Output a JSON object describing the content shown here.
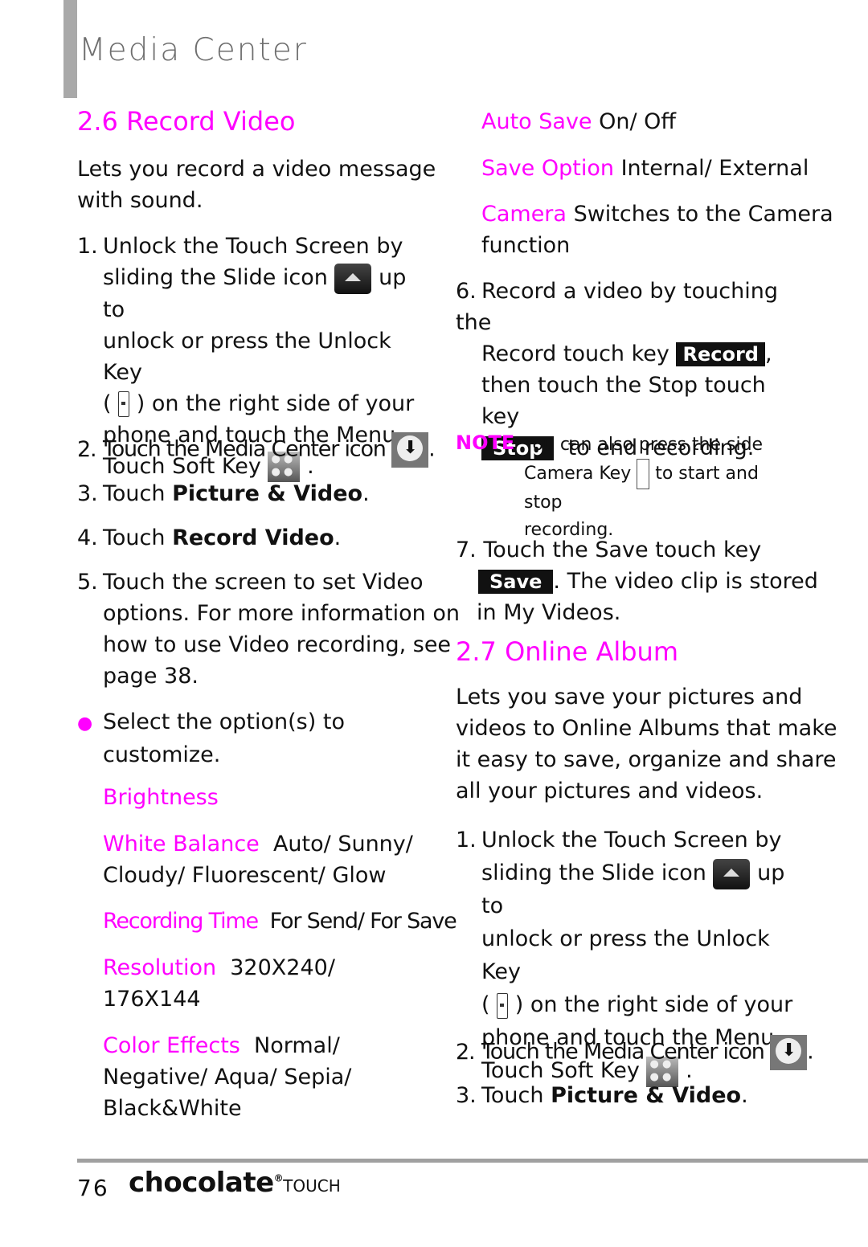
{
  "header": {
    "chapter": "Media Center"
  },
  "left": {
    "section_title": "2.6 Record Video",
    "intro": [
      "Lets you record a video message",
      "with sound."
    ],
    "step1": {
      "num": "1.",
      "l1": "Unlock the Touch Screen by",
      "l2a": "sliding the Slide icon",
      "l2b": "up to",
      "l3": "unlock or press the Unlock Key",
      "l4a": "(",
      "l4b": ") on the right side of your",
      "l5": "phone and touch the Menu",
      "l6": "Touch Soft Key",
      "l6end": "."
    },
    "step2": {
      "num": "2.",
      "text": "Touch the Media Center icon",
      "end": "."
    },
    "step3": {
      "num": "3.",
      "pre": "Touch ",
      "bold": "Picture & Video",
      "end": "."
    },
    "step4": {
      "num": "4.",
      "pre": "Touch ",
      "bold": "Record Video",
      "end": "."
    },
    "step5": {
      "num": "5.",
      "lines": [
        "Touch the screen to set Video",
        "options. For more information on",
        "how to use Video recording, see",
        "page 38."
      ]
    },
    "bullet": {
      "symbol": "●",
      "lines": [
        "Select the option(s) to",
        "customize."
      ]
    },
    "options": {
      "brightness": {
        "label": "Brightness"
      },
      "white_balance": {
        "label": "White Balance",
        "value1": "Auto/ Sunny/",
        "value2": "Cloudy/ Fluorescent/ Glow"
      },
      "recording_time": {
        "label": "Recording Time",
        "value": "For Send/ For Save"
      },
      "resolution": {
        "label": "Resolution",
        "value1": "320X240/",
        "value2": "176X144"
      },
      "color_effects": {
        "label": "Color Effects",
        "value1": "Normal/",
        "value2": "Negative/ Aqua/ Sepia/",
        "value3": "Black&White"
      }
    }
  },
  "right": {
    "options": {
      "auto_save": {
        "label": "Auto Save",
        "value": "On/ Off"
      },
      "save_option": {
        "label": "Save Option",
        "value": "Internal/ External"
      },
      "camera": {
        "label": "Camera",
        "value1": "Switches to the Camera",
        "value2": "function"
      }
    },
    "step6": {
      "num": "6.",
      "l1": "Record a video by touching the",
      "l2": "Record touch key",
      "record_key": "Record",
      "l2end": ",",
      "l3": "then touch the Stop touch key",
      "stop_key": "Stop",
      "l4": "to end recording."
    },
    "note": {
      "label": "NOTE",
      "l1": "You can also press the side",
      "l2a": "Camera Key",
      "l2b": "to start and stop",
      "l3": "recording."
    },
    "step7": {
      "num": "7.",
      "l1": "Touch the Save touch key",
      "save_key": "Save",
      "l2": ".  The video clip is stored",
      "l3": "in My Videos."
    },
    "section_title": "2.7 Online Album",
    "intro": [
      "Lets you save your pictures and",
      "videos to Online Albums that make",
      "it easy to save, organize and share",
      "all your pictures and videos."
    ],
    "step1": {
      "num": "1.",
      "l1": "Unlock the Touch Screen by",
      "l2a": "sliding the Slide icon",
      "l2b": "up to",
      "l3": "unlock or press the Unlock Key",
      "l4a": "(",
      "l4b": ") on the right side of your",
      "l5": "phone and touch the Menu",
      "l6": "Touch Soft Key",
      "l6end": "."
    },
    "step2": {
      "num": "2.",
      "text": "Touch the Media Center icon",
      "end": "."
    },
    "step3": {
      "num": "3.",
      "pre": "Touch ",
      "bold": "Picture & Video",
      "end": "."
    }
  },
  "footer": {
    "page": "76",
    "brand": "chocolate",
    "brand_suffix": "TOUCH",
    "reg": "®"
  }
}
